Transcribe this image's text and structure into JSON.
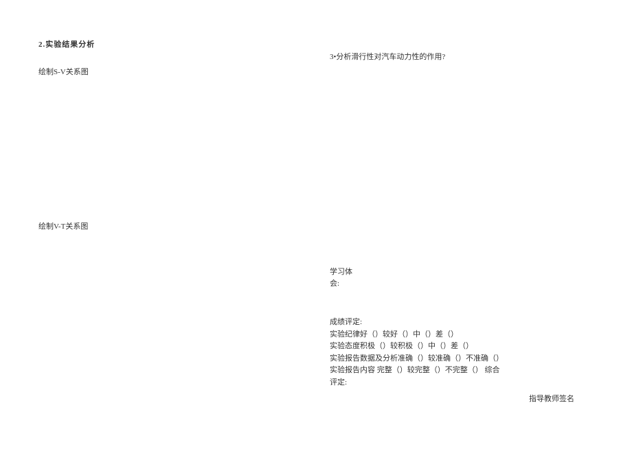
{
  "left": {
    "section_title": "2.实验结果分析",
    "sv_label": "绘制S-V关系图",
    "vt_label": "绘制V-T关系图"
  },
  "right": {
    "q3": "3•分析滑行性对汽车动力性的作用?",
    "study_line1": "学习体",
    "study_line2": "会:",
    "grade_title": "成绩评定:",
    "grade_line1": "实验纪律好（）较好（）中（）差（）",
    "grade_line2": "实验态度积极（）较积极（）中（）差（）",
    "grade_line3": "实验报告数据及分析准确（）较准确（）不准确（）",
    "grade_line4": "实验报告内容 完整（）较完整（）不完整（） 综合",
    "grade_line5": "评定:",
    "signature": "指导教师签名"
  }
}
